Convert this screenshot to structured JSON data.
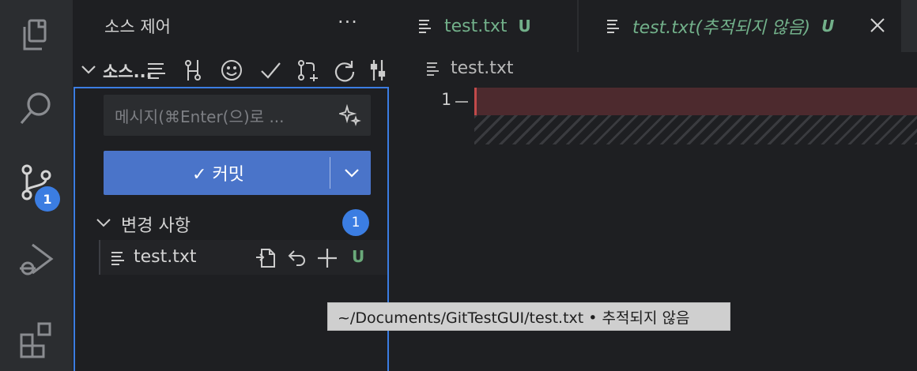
{
  "activity": {
    "badge": "1",
    "items": [
      "explorer-icon",
      "search-icon",
      "source-control-icon",
      "run-debug-icon",
      "extensions-icon"
    ]
  },
  "sidebar": {
    "title": "소스 제어",
    "more": "···",
    "section_label": "소스...",
    "commit_placeholder": "메시지(⌘Enter(으)로 ...",
    "commit_label": "✓ 커밋",
    "changes_label": "변경 사항",
    "changes_count": "1",
    "file": {
      "name": "test.txt",
      "status": "U"
    }
  },
  "tabs": [
    {
      "name": "test.txt",
      "status": "U"
    },
    {
      "name": "test.txt(추적되지 않음)",
      "status": "U"
    }
  ],
  "editor": {
    "breadcrumb": "test.txt",
    "line_number": "1"
  },
  "tooltip": "~/Documents/GitTestGUI/test.txt • 추적되지 않음",
  "colors": {
    "accent": "#3b7de2",
    "commit_button": "#4a74c9",
    "untracked_green": "#72b08a",
    "deleted_line": "#4d2a2e"
  }
}
